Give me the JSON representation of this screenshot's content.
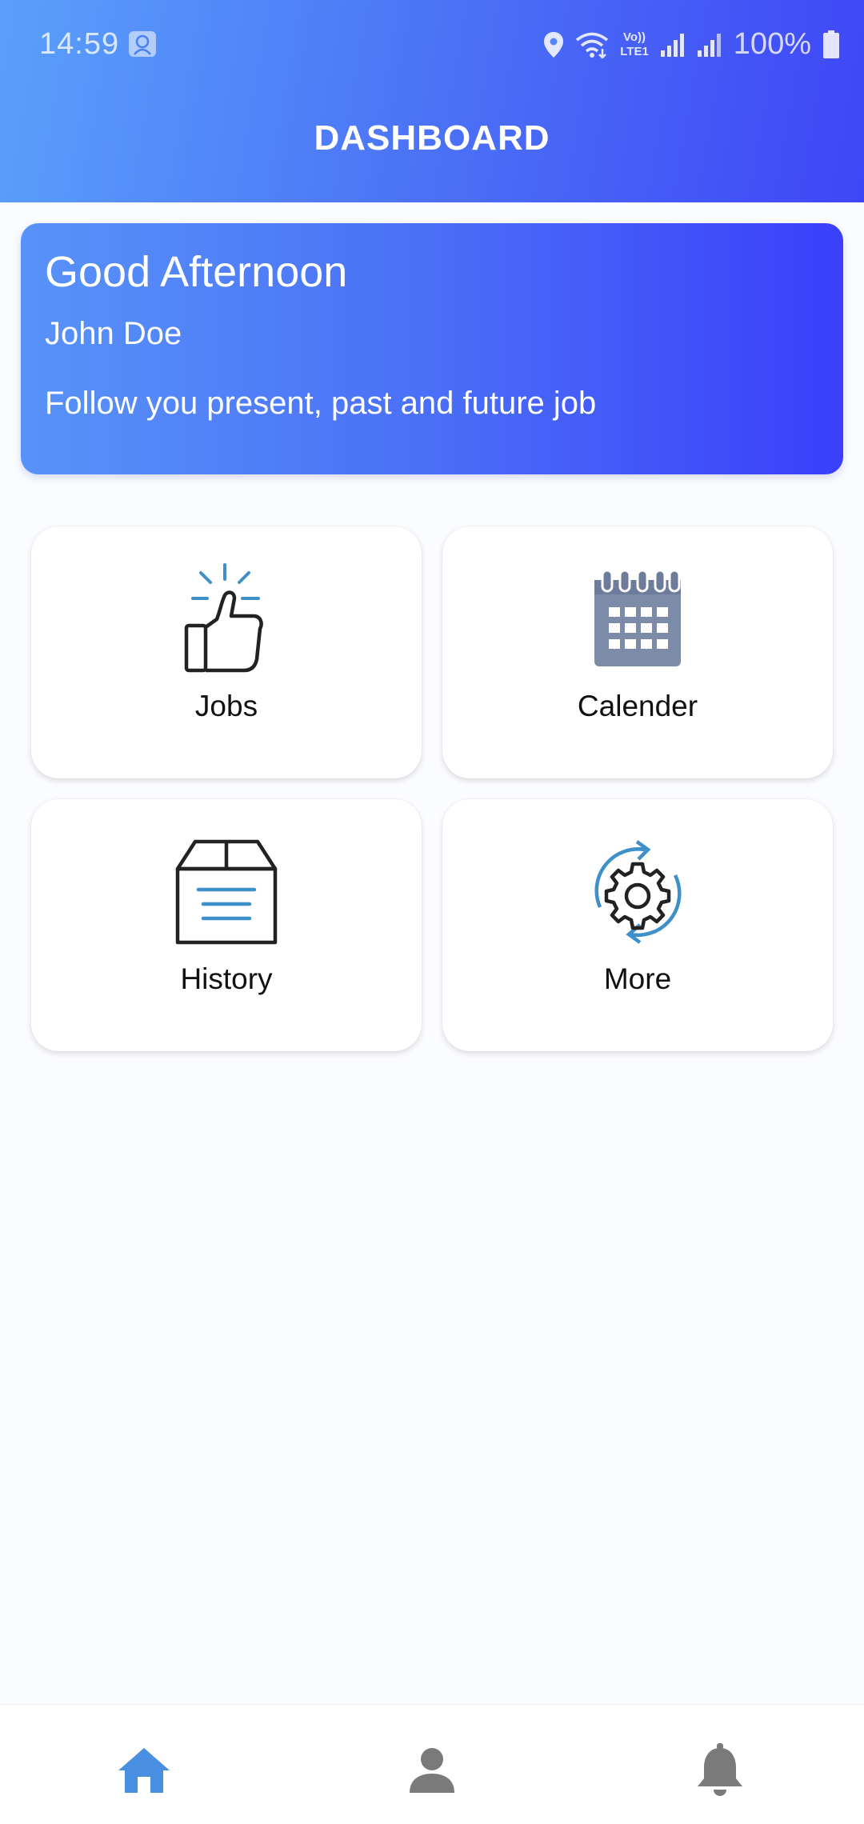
{
  "status_bar": {
    "time": "14:59",
    "battery": "100%",
    "network_label_top": "Vo))",
    "network_label_bottom": "LTE1",
    "icons": [
      "app-notification-icon",
      "location-icon",
      "wifi-icon",
      "signal-icon",
      "signal-icon",
      "battery-icon"
    ]
  },
  "header": {
    "title": "DASHBOARD"
  },
  "greeting": {
    "title": "Good Afternoon",
    "name": "John Doe",
    "subtitle": "Follow you present, past and future job"
  },
  "tiles": [
    {
      "label": "Jobs",
      "icon": "thumbs-up-icon"
    },
    {
      "label": "Calender",
      "icon": "calendar-icon"
    },
    {
      "label": "History",
      "icon": "archive-box-icon"
    },
    {
      "label": "More",
      "icon": "gear-refresh-icon"
    }
  ],
  "bottom_nav": {
    "items": [
      {
        "icon": "home-icon",
        "active": true
      },
      {
        "icon": "profile-icon",
        "active": false
      },
      {
        "icon": "bell-icon",
        "active": false
      }
    ]
  },
  "colors": {
    "header_gradient_start": "#5aa0fb",
    "header_gradient_end": "#3f46f7",
    "accent_blue": "#4a90e2",
    "icon_gray": "#7a7a7a",
    "calendar_slate": "#7b8ba8"
  }
}
